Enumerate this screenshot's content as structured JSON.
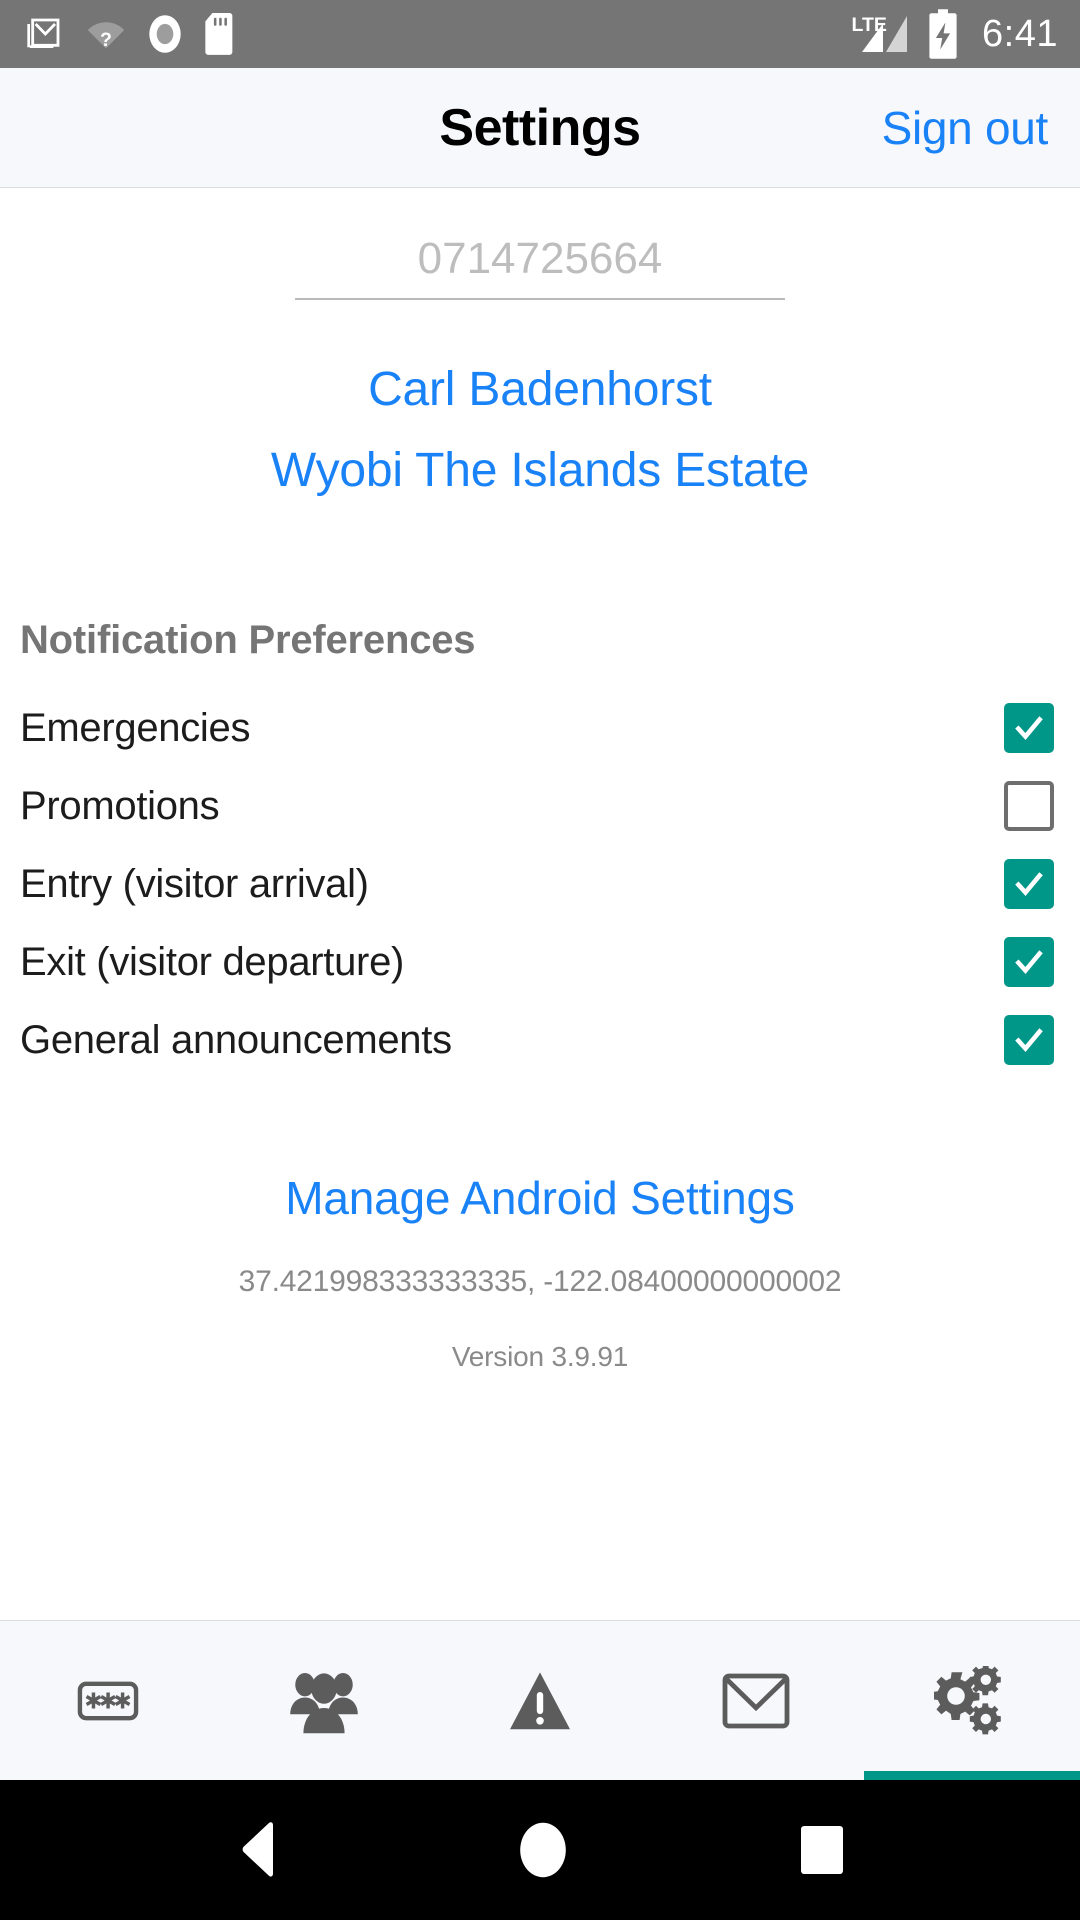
{
  "status_bar": {
    "icons": [
      "gmail-icon",
      "wifi-unknown-icon",
      "record-icon",
      "sd-card-icon"
    ],
    "network_label": "LTE",
    "signal_icon": "signal-bars-icon",
    "battery_icon": "battery-charging-icon",
    "clock": "6:41",
    "background_color": "#757575"
  },
  "app_bar": {
    "title": "Settings",
    "sign_out_label": "Sign out",
    "link_color": "#1a82f7"
  },
  "profile": {
    "phone_placeholder": "0714725664",
    "phone_value": "",
    "user_name": "Carl Badenhorst",
    "estate_name": "Wyobi The Islands Estate"
  },
  "notifications": {
    "section_title": "Notification Preferences",
    "checked_color": "#009688",
    "items": [
      {
        "label": "Emergencies",
        "checked": true
      },
      {
        "label": "Promotions",
        "checked": false
      },
      {
        "label": "Entry (visitor arrival)",
        "checked": true
      },
      {
        "label": "Exit (visitor departure)",
        "checked": true
      },
      {
        "label": "General announcements",
        "checked": true
      }
    ]
  },
  "footer": {
    "manage_link": "Manage Android Settings",
    "coordinates": "37.421998333333335, -122.08400000000002",
    "version": "Version 3.9.91"
  },
  "tab_bar": {
    "active_index": 4,
    "accent_color": "#009688",
    "tabs": [
      {
        "name": "tab-pin",
        "icon": "password-field-icon"
      },
      {
        "name": "tab-residents",
        "icon": "people-group-icon"
      },
      {
        "name": "tab-panic",
        "icon": "warning-triangle-icon"
      },
      {
        "name": "tab-messages",
        "icon": "envelope-icon"
      },
      {
        "name": "tab-settings",
        "icon": "gears-icon"
      }
    ]
  },
  "nav_bar": {
    "buttons": [
      {
        "name": "android-back-button",
        "icon": "triangle-back-icon"
      },
      {
        "name": "android-home-button",
        "icon": "circle-home-icon"
      },
      {
        "name": "android-recents-button",
        "icon": "square-recents-icon"
      }
    ]
  }
}
